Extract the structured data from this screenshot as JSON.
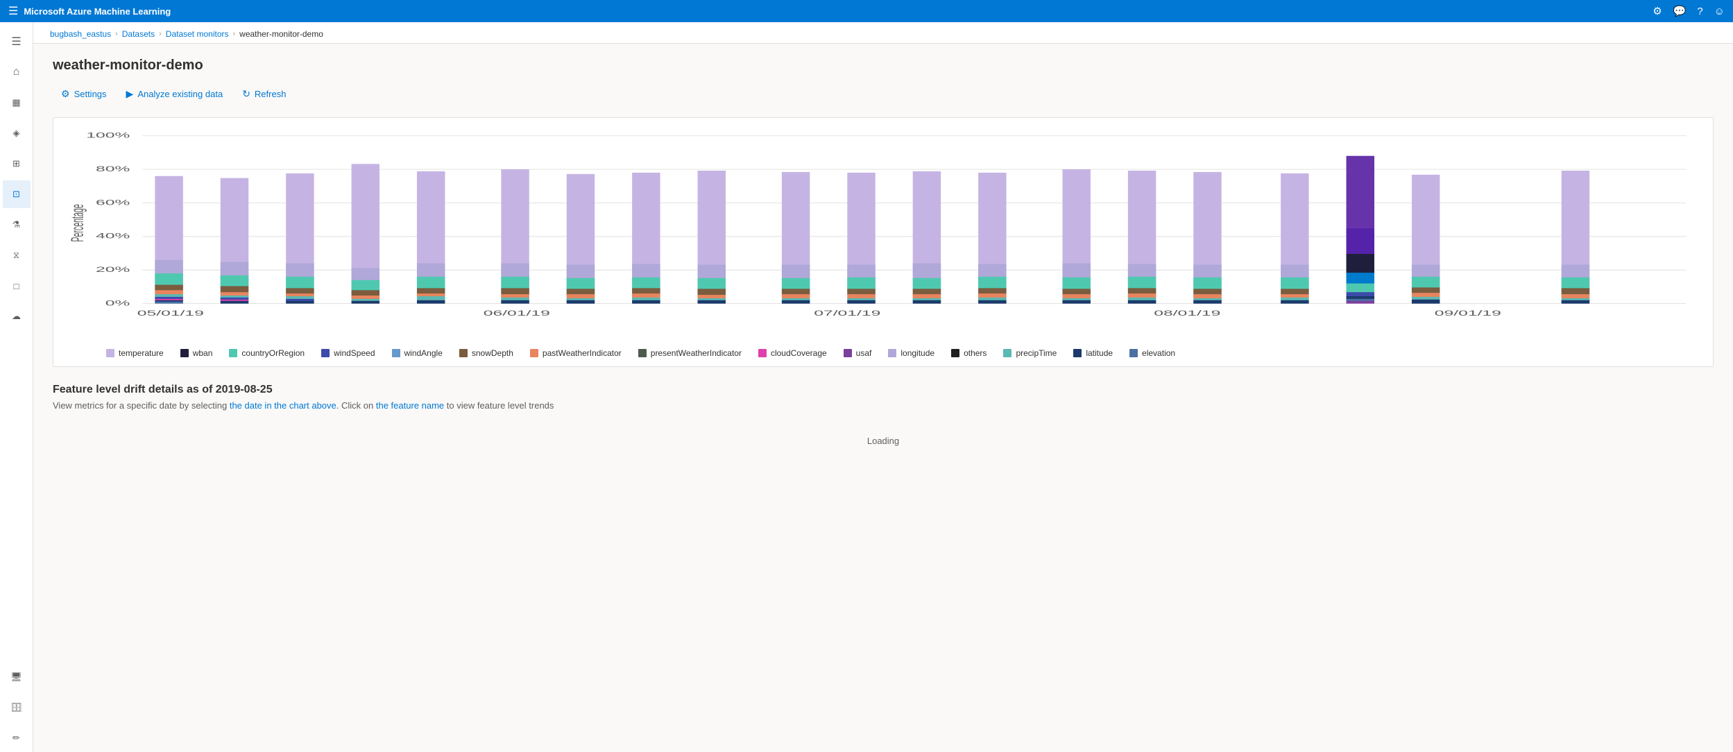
{
  "topbar": {
    "title": "Microsoft Azure Machine Learning",
    "icons": [
      "settings-icon",
      "feedback-icon",
      "help-icon",
      "account-icon"
    ]
  },
  "breadcrumb": {
    "items": [
      {
        "label": "bugbash_eastus",
        "link": true
      },
      {
        "label": "Datasets",
        "link": true
      },
      {
        "label": "Dataset monitors",
        "link": true
      },
      {
        "label": "weather-monitor-demo",
        "link": false
      }
    ],
    "separator": "›"
  },
  "page": {
    "title": "weather-monitor-demo"
  },
  "toolbar": {
    "settings_label": "Settings",
    "analyze_label": "Analyze existing data",
    "refresh_label": "Refresh"
  },
  "chart": {
    "y_label": "Percentage",
    "y_ticks": [
      "100%",
      "80%",
      "60%",
      "40%",
      "20%",
      "0%"
    ],
    "x_labels": [
      "05/01/19",
      "06/01/19",
      "07/01/19",
      "08/01/19",
      "09/01/19"
    ]
  },
  "legend": {
    "items": [
      {
        "label": "temperature",
        "color": "#c5b4e3"
      },
      {
        "label": "wban",
        "color": "#1f1f3d"
      },
      {
        "label": "countryOrRegion",
        "color": "#4ec9b0"
      },
      {
        "label": "windSpeed",
        "color": "#3b4aab"
      },
      {
        "label": "windAngle",
        "color": "#6699cc"
      },
      {
        "label": "snowDepth",
        "color": "#7b5c3e"
      },
      {
        "label": "pastWeatherIndicator",
        "color": "#e8855e"
      },
      {
        "label": "presentWeatherIndicator",
        "color": "#4d5c4d"
      },
      {
        "label": "cloudCoverage",
        "color": "#e040ab"
      },
      {
        "label": "usaf",
        "color": "#7b3f9e"
      },
      {
        "label": "longitude",
        "color": "#b0a8d8"
      },
      {
        "label": "others",
        "color": "#1f1f1f"
      },
      {
        "label": "precipTime",
        "color": "#5cb8b2"
      },
      {
        "label": "latitude",
        "color": "#1a3a6b"
      },
      {
        "label": "elevation",
        "color": "#4a6fa5"
      }
    ]
  },
  "drift_section": {
    "title": "Feature level drift details as of 2019-08-25",
    "subtitle_start": "View metrics for a specific date by selecting ",
    "subtitle_link1": "the date in the chart above",
    "subtitle_mid": ". Click on ",
    "subtitle_link2": "the feature name",
    "subtitle_end": " to view feature level trends",
    "loading": "Loading"
  }
}
